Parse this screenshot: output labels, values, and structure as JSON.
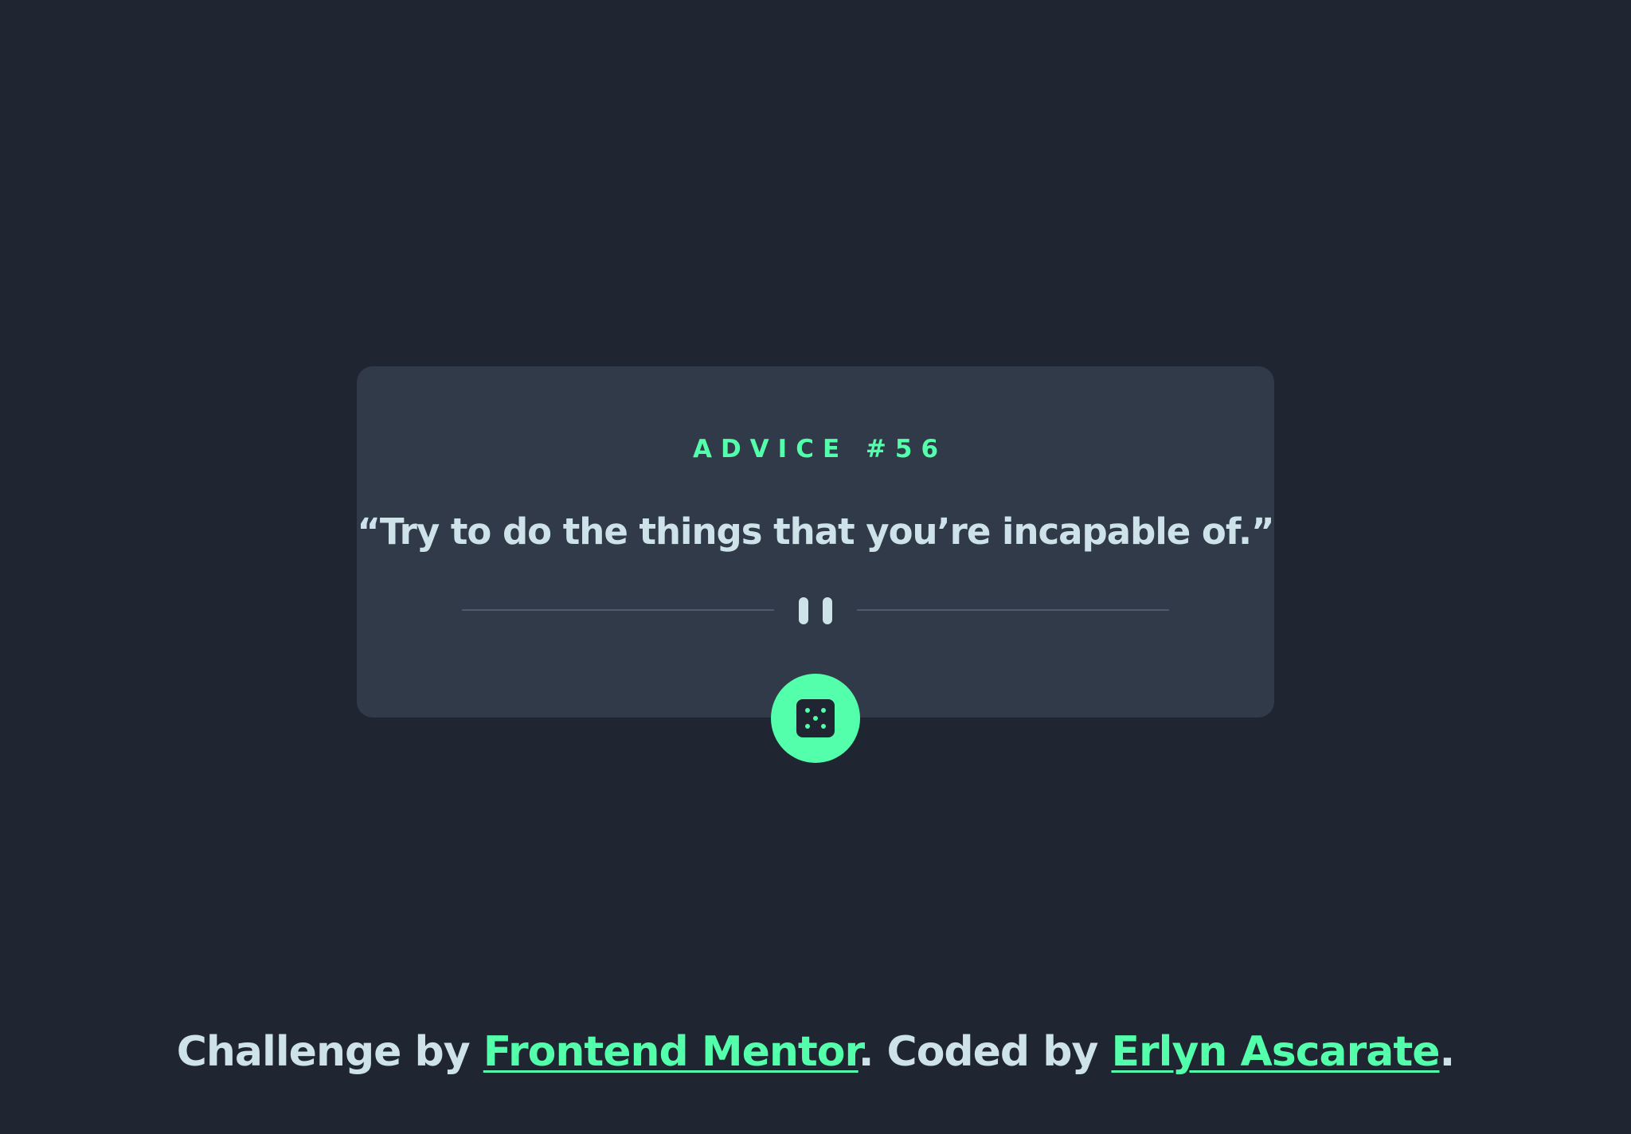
{
  "advice": {
    "id_label": "ADVICE #56",
    "quote": "“Try to do the things that you’re incapable of.”"
  },
  "divider": {
    "icon": "pause-icon"
  },
  "dice_button": {
    "icon": "dice-icon"
  },
  "footer": {
    "prefix": "Challenge by ",
    "link1": "Frontend Mentor",
    "middle": ". Coded by ",
    "link2": "Erlyn Ascarate",
    "suffix": "."
  },
  "colors": {
    "background": "#1f2632",
    "card": "#313a49",
    "accent": "#53ffaa",
    "text": "#cee3e9",
    "divider": "#4f5b6d"
  }
}
